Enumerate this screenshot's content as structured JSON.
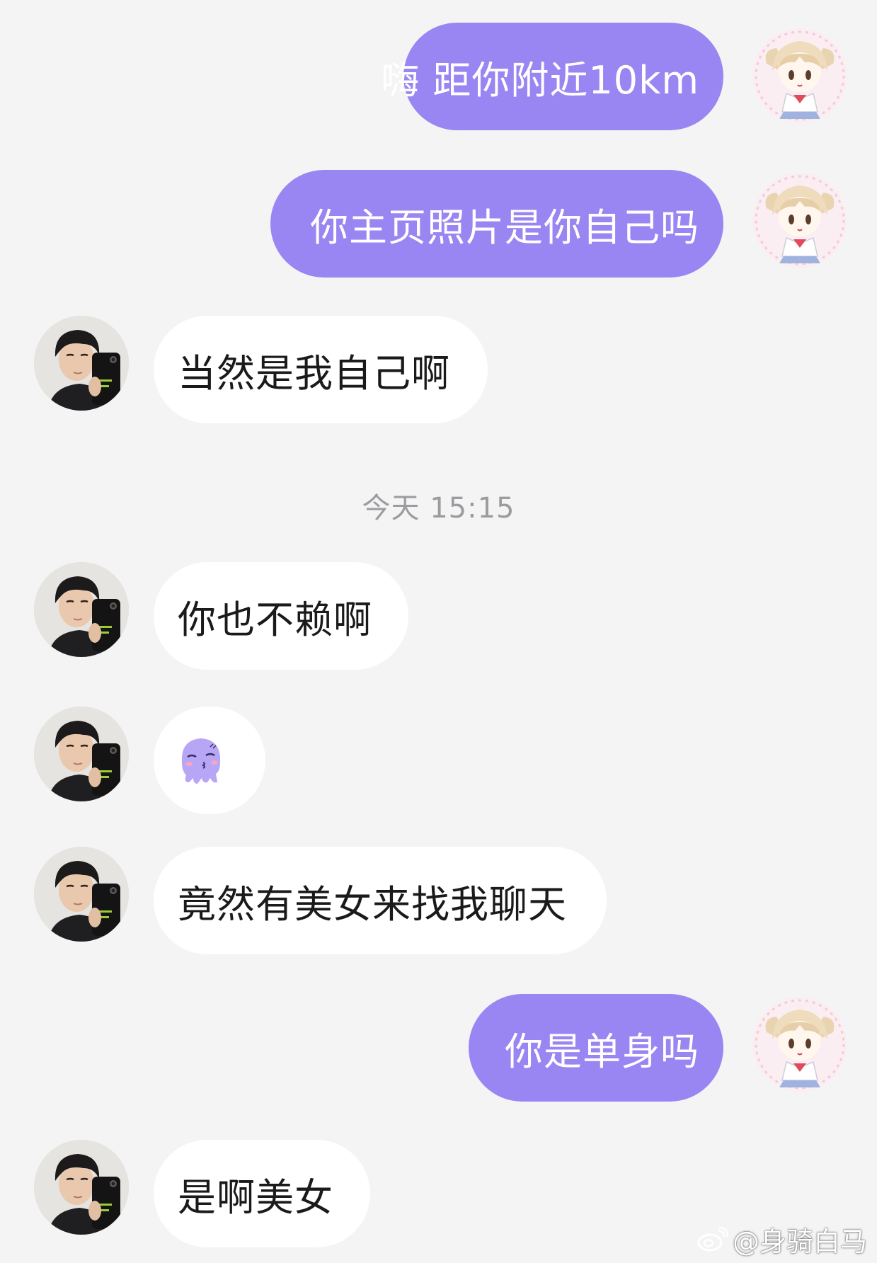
{
  "messages": [
    {
      "id": 1,
      "direction": "outgoing",
      "sender": "self",
      "text": "嗨 距你附近10km"
    },
    {
      "id": 2,
      "direction": "outgoing",
      "sender": "self",
      "text": "你主页照片是你自己吗"
    },
    {
      "id": 3,
      "direction": "incoming",
      "sender": "contact",
      "text": "当然是我自己啊"
    },
    {
      "id": 4,
      "direction": "incoming",
      "sender": "contact",
      "text": "你也不赖啊"
    },
    {
      "id": 5,
      "direction": "incoming",
      "sender": "contact",
      "type": "sticker",
      "sticker": "shy-purple-octopus-icon"
    },
    {
      "id": 6,
      "direction": "incoming",
      "sender": "contact",
      "text": "竟然有美女来找我聊天"
    },
    {
      "id": 7,
      "direction": "outgoing",
      "sender": "self",
      "text": "你是单身吗"
    },
    {
      "id": 8,
      "direction": "incoming",
      "sender": "contact",
      "text": "是啊美女"
    }
  ],
  "timestamp": "今天 15:15",
  "watermark": "@身骑白马",
  "colors": {
    "background": "#f4f4f5",
    "outgoing_bubble": "#9a86f2",
    "incoming_bubble": "#ffffff",
    "timestamp_text": "#9c9c9f",
    "sticker": "#b7a6f5"
  },
  "icons": {
    "self_avatar": "anime-dog-girl-avatar",
    "contact_avatar": "selfie-boy-avatar",
    "watermark_logo": "weibo-icon"
  }
}
